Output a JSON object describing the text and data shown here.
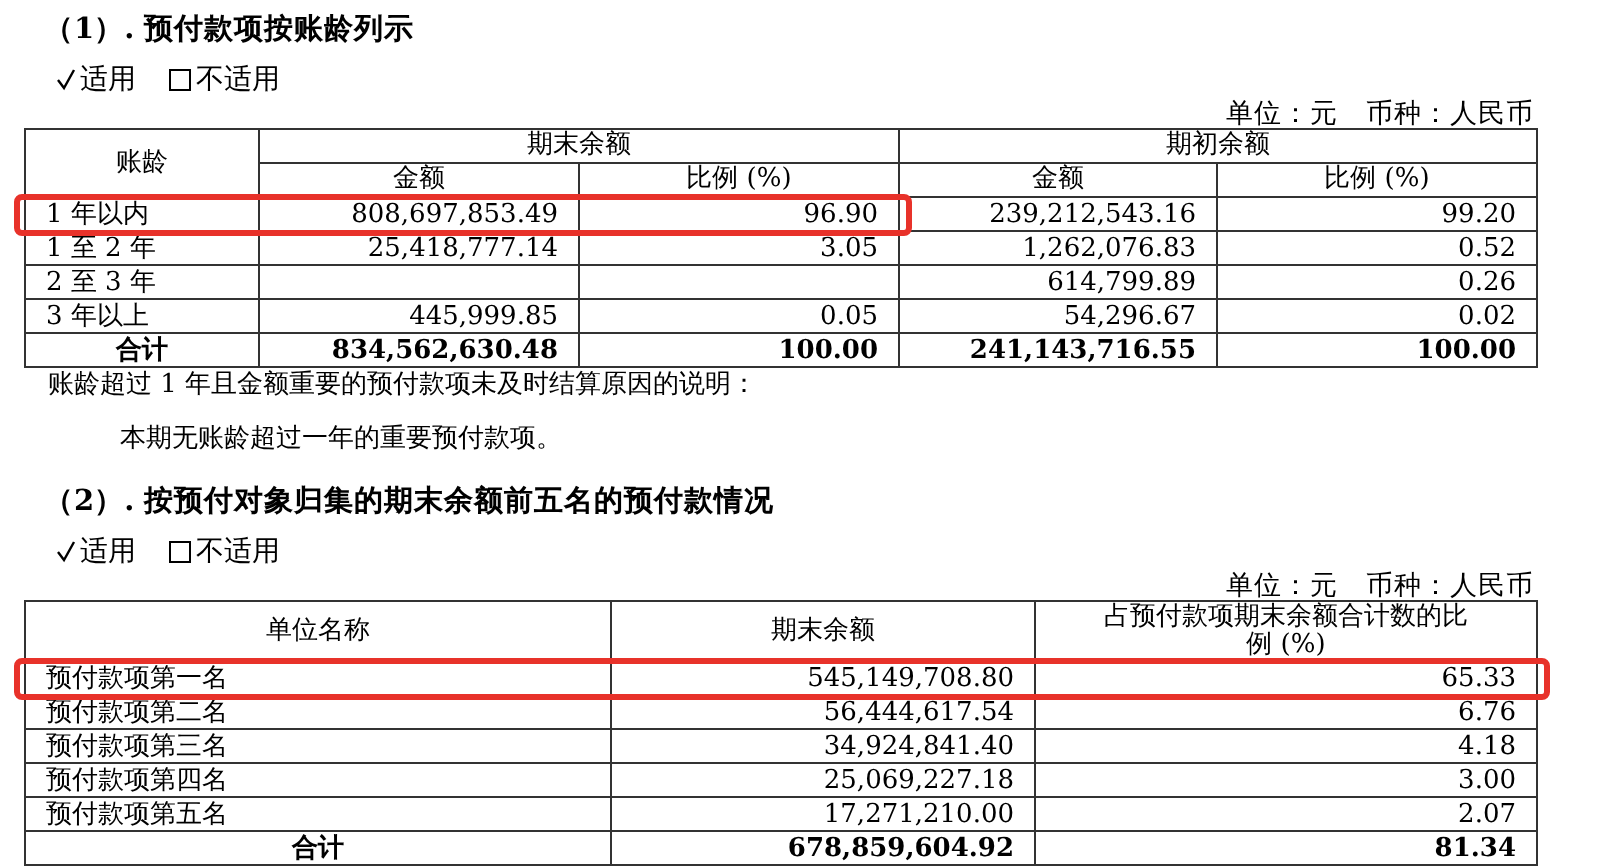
{
  "sections": [
    {
      "title": "（1）. 预付款项按账龄列示",
      "options": [
        {
          "label": "适用",
          "checked": true
        },
        {
          "label": "不适用",
          "checked": false
        }
      ],
      "unit": "单位：元　币种：人民币",
      "table": {
        "row_header": "账龄",
        "groups": [
          {
            "label": "期末余额",
            "columns": [
              "金额",
              "比例 (%)"
            ]
          },
          {
            "label": "期初余额",
            "columns": [
              "金额",
              "比例 (%)"
            ]
          }
        ],
        "rows": [
          {
            "kind": "data",
            "cells": [
              {
                "text": "1 年以内",
                "highlighted": true
              },
              {
                "text": "808,697,853.49",
                "highlighted": true
              },
              {
                "text": "96.90",
                "highlighted": true
              },
              {
                "text": "239,212,543.16",
                "highlighted": false
              },
              {
                "text": "99.20",
                "highlighted": false
              }
            ]
          },
          {
            "kind": "data",
            "cells": [
              {
                "text": "1 至 2 年",
                "highlighted": false
              },
              {
                "text": "25,418,777.14",
                "highlighted": false
              },
              {
                "text": "3.05",
                "highlighted": false
              },
              {
                "text": "1,262,076.83",
                "highlighted": false
              },
              {
                "text": "0.52",
                "highlighted": false
              }
            ]
          },
          {
            "kind": "data",
            "cells": [
              {
                "text": "2 至 3 年",
                "highlighted": false
              },
              null,
              null,
              {
                "text": "614,799.89",
                "highlighted": false
              },
              {
                "text": "0.26",
                "highlighted": false
              }
            ]
          },
          {
            "kind": "data",
            "cells": [
              {
                "text": "3 年以上",
                "highlighted": false
              },
              {
                "text": "445,999.85",
                "highlighted": false
              },
              {
                "text": "0.05",
                "highlighted": false
              },
              {
                "text": "54,296.67",
                "highlighted": false
              },
              {
                "text": "0.02",
                "highlighted": false
              }
            ]
          },
          {
            "kind": "total",
            "cells": [
              {
                "text": "合计",
                "highlighted": false
              },
              {
                "text": "834,562,630.48",
                "highlighted": false
              },
              {
                "text": "100.00",
                "highlighted": false
              },
              {
                "text": "241,143,716.55",
                "highlighted": false
              },
              {
                "text": "100.00",
                "highlighted": false
              }
            ]
          }
        ]
      },
      "notes": [
        {
          "text": "账龄超过 1 年且金额重要的预付款项未及时结算原因的说明：",
          "kind": "lead"
        },
        {
          "text": "本期无账龄超过一年的重要预付款项。",
          "kind": "body"
        }
      ]
    },
    {
      "title": "（2）. 按预付对象归集的期末余额前五名的预付款情况",
      "options": [
        {
          "label": "适用",
          "checked": true
        },
        {
          "label": "不适用",
          "checked": false
        }
      ],
      "unit": "单位：元　币种：人民币",
      "table": {
        "header": [
          "单位名称",
          "期末余额",
          "占预付款项期末余额合计数的比例 (%)"
        ],
        "rows": [
          {
            "kind": "data",
            "cells": [
              {
                "text": "预付款项第一名",
                "highlighted": true
              },
              {
                "text": "545,149,708.80",
                "highlighted": true
              },
              {
                "text": "65.33",
                "highlighted": true
              }
            ]
          },
          {
            "kind": "data",
            "cells": [
              {
                "text": "预付款项第二名",
                "highlighted": false
              },
              {
                "text": "56,444,617.54",
                "highlighted": false
              },
              {
                "text": "6.76",
                "highlighted": false
              }
            ]
          },
          {
            "kind": "data",
            "cells": [
              {
                "text": "预付款项第三名",
                "highlighted": false
              },
              {
                "text": "34,924,841.40",
                "highlighted": false
              },
              {
                "text": "4.18",
                "highlighted": false
              }
            ]
          },
          {
            "kind": "data",
            "cells": [
              {
                "text": "预付款项第四名",
                "highlighted": false
              },
              {
                "text": "25,069,227.18",
                "highlighted": false
              },
              {
                "text": "3.00",
                "highlighted": false
              }
            ]
          },
          {
            "kind": "data",
            "cells": [
              {
                "text": "预付款项第五名",
                "highlighted": false
              },
              {
                "text": "17,271,210.00",
                "highlighted": false
              },
              {
                "text": "2.07",
                "highlighted": false
              }
            ]
          },
          {
            "kind": "total",
            "cells": [
              {
                "text": "合计",
                "highlighted": false
              },
              {
                "text": "678,859,604.92",
                "highlighted": false
              },
              {
                "text": "81.34",
                "highlighted": false
              }
            ]
          }
        ]
      }
    }
  ]
}
